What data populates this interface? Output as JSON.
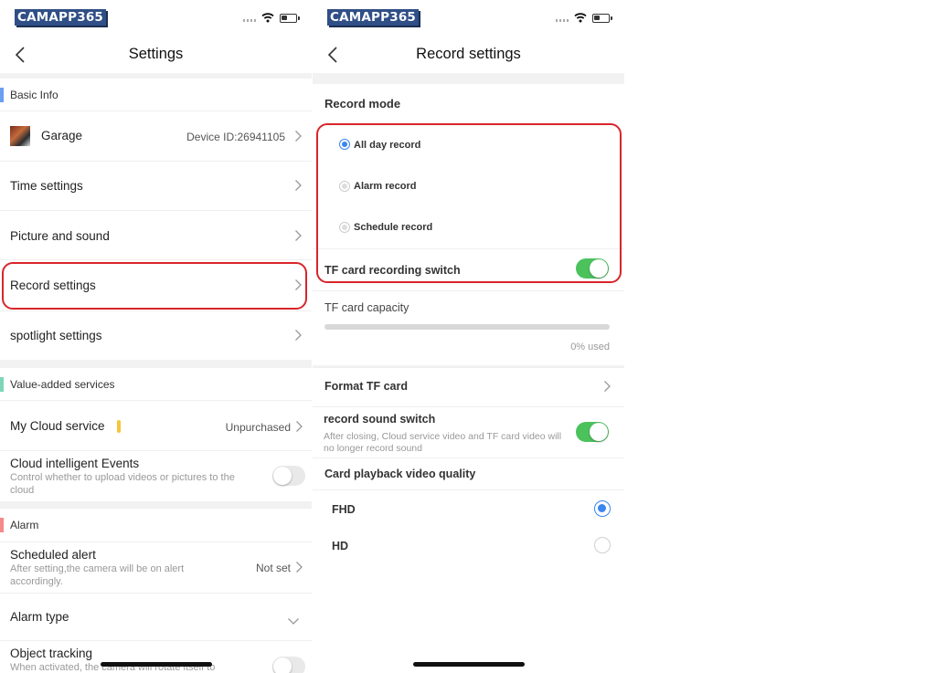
{
  "brand": "CAMAPP365",
  "settings": {
    "title": "Settings",
    "basic_info": {
      "header": "Basic Info",
      "device_name": "Garage",
      "device_id": "Device ID:26941105",
      "items": [
        "Time settings",
        "Picture and sound",
        "Record settings",
        "spotlight settings"
      ]
    },
    "value_added": {
      "header": "Value-added services",
      "cloud_service": "My Cloud service",
      "cloud_status": "Unpurchased",
      "cloud_events": "Cloud intelligent Events",
      "cloud_events_desc": "Control whether to upload videos or pictures to the cloud",
      "cloud_events_enabled": false
    },
    "alarm": {
      "header": "Alarm",
      "scheduled_alert": "Scheduled alert",
      "scheduled_alert_desc": "After setting,the camera will be on alert accordingly.",
      "scheduled_alert_value": "Not set",
      "alarm_type": "Alarm type",
      "object_tracking": "Object tracking",
      "object_tracking_desc": "When activated, the camera will rotate itself to",
      "object_tracking_enabled": false
    }
  },
  "record_settings": {
    "title": "Record settings",
    "record_mode": "Record mode",
    "modes": [
      "All day record",
      "Alarm record",
      "Schedule record"
    ],
    "selected_mode": "All day record",
    "tf_switch": "TF card recording switch",
    "tf_switch_enabled": true,
    "tf_capacity": "TF card capacity",
    "tf_used": "0% used",
    "tf_used_fraction": 0,
    "format_tf": "Format TF card",
    "sound_switch": "record sound switch",
    "sound_switch_desc": "After closing, Cloud service video and TF card video will no longer record sound",
    "sound_switch_enabled": true,
    "quality_title": "Card playback video quality",
    "quality_options": [
      "FHD",
      "HD"
    ],
    "selected_quality": "FHD"
  },
  "colors": {
    "brand_bg": "#2f4f86",
    "highlight": "#d9252b",
    "toggle_on": "#4cc25d",
    "radio_selected": "#3a86f0",
    "basic_info_bar": "#6a9ff2",
    "value_added_bar": "#7ed6b9",
    "alarm_bar": "#f48a8a",
    "cloud_badge": "#f5c53a"
  }
}
